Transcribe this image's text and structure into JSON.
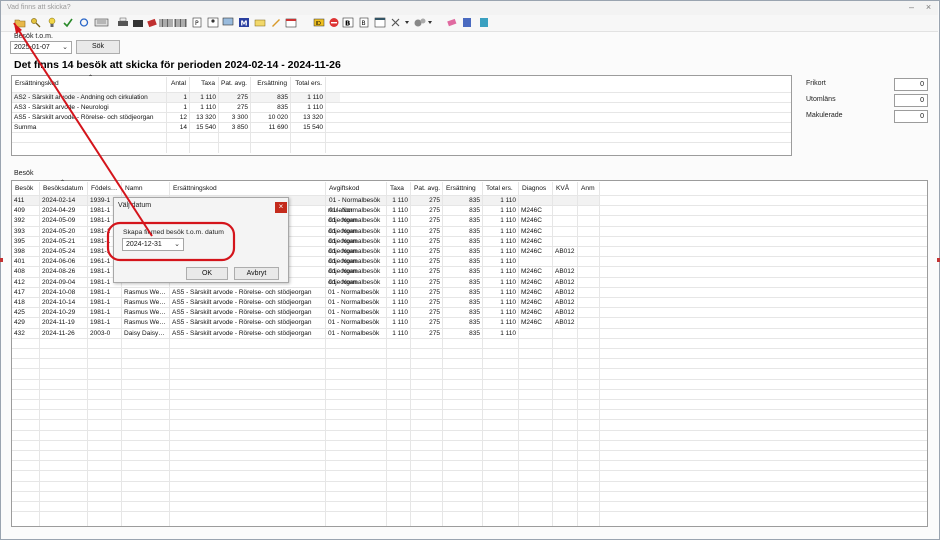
{
  "window": {
    "title": "Vad finns att skicka?",
    "minimize": "–",
    "close": "×"
  },
  "toolbar": {
    "icons": [
      "open-folder-icon",
      "key-icon",
      "lightbulb-icon",
      "check-icon",
      "refresh-icon",
      "keyboard-icon",
      "print-icon",
      "briefcase-icon",
      "eraser-icon",
      "barcode-icon",
      "barcode-icon",
      "barcode-icon",
      "document-p-icon",
      "patient-icon",
      "monitor-icon",
      "m-icon",
      "envelope-icon",
      "pen-icon",
      "calendar-icon",
      "id-icon",
      "stop-icon",
      "b-icon",
      "doc-b-icon",
      "window-icon",
      "tools-icon",
      "gears-icon",
      "eraser-icon",
      "book-icon",
      "document-icon"
    ]
  },
  "search": {
    "label": "Besök t.o.m.",
    "date": "2025-01-07",
    "button": "Sök"
  },
  "heading": "Det finns 14 besök att skicka för perioden 2024-02-14 - 2024-11-26",
  "summary": {
    "columns": [
      "Ersättningskod",
      "Antal",
      "Taxa",
      "Pat. avg.",
      "Ersättning",
      "Total ers."
    ],
    "rows": [
      [
        "AS2 - Särskilt arvode - Andning och cirkulation",
        "1",
        "1 110",
        "275",
        "835",
        "1 110"
      ],
      [
        "AS3 - Särskilt arvode - Neurologi",
        "1",
        "1 110",
        "275",
        "835",
        "1 110"
      ],
      [
        "AS5 - Särskilt arvode - Rörelse- och stödjeorgan",
        "12",
        "13 320",
        "3 300",
        "10 020",
        "13 320"
      ],
      [
        "Summa",
        "14",
        "15 540",
        "3 850",
        "11 690",
        "15 540"
      ]
    ]
  },
  "counts": [
    {
      "label": "Frikort",
      "value": "0"
    },
    {
      "label": "Utomläns",
      "value": "0"
    },
    {
      "label": "Makulerade",
      "value": "0"
    }
  ],
  "visits": {
    "section_label": "Besök",
    "columns": [
      "Besök",
      "Besöksdatum",
      "Födels…",
      "Namn",
      "Ersättningskod",
      "Avgiftskod",
      "Taxa",
      "Pat. avg.",
      "Ersättning",
      "Total ers.",
      "Diagnos",
      "KVÅ",
      "Anm"
    ],
    "rows": [
      [
        "411",
        "2024-02-14",
        "1939-1",
        "",
        "",
        "",
        "1 110",
        "275",
        "835",
        "1 110",
        "",
        "",
        ""
      ],
      [
        "409",
        "2024-04-29",
        "1981-1",
        "",
        "",
        "rkulation",
        "1 110",
        "275",
        "835",
        "1 110",
        "M246C",
        "",
        ""
      ],
      [
        "392",
        "2024-05-09",
        "1981-1",
        "",
        "",
        "ödjeorgan",
        "1 110",
        "275",
        "835",
        "1 110",
        "M246C",
        "",
        ""
      ],
      [
        "393",
        "2024-05-20",
        "1981-1",
        "",
        "",
        "ödjeorgan",
        "1 110",
        "275",
        "835",
        "1 110",
        "M246C",
        "",
        ""
      ],
      [
        "395",
        "2024-05-21",
        "1981-1",
        "",
        "",
        "ödjeorgan",
        "1 110",
        "275",
        "835",
        "1 110",
        "M246C",
        "",
        ""
      ],
      [
        "398",
        "2024-05-24",
        "1981-1",
        "",
        "",
        "ödjeorgan",
        "1 110",
        "275",
        "835",
        "1 110",
        "M246C",
        "AB012",
        ""
      ],
      [
        "401",
        "2024-06-06",
        "1961-1",
        "",
        "",
        "ödjeorgan",
        "1 110",
        "275",
        "835",
        "1 110",
        "",
        "",
        ""
      ],
      [
        "408",
        "2024-08-26",
        "1981-1",
        "",
        "",
        "ödjeorgan",
        "1 110",
        "275",
        "835",
        "1 110",
        "M246C",
        "AB012",
        ""
      ],
      [
        "412",
        "2024-09-04",
        "1981-1",
        "",
        "",
        "ödjeorgan",
        "1 110",
        "275",
        "835",
        "1 110",
        "M246C",
        "AB012",
        ""
      ],
      [
        "417",
        "2024-10-08",
        "1981-1",
        "Rasmus We…",
        "AS5 - Särskilt arvode - Rörelse- och stödjeorgan",
        "01 - Normalbesök",
        "1 110",
        "275",
        "835",
        "1 110",
        "M246C",
        "AB012",
        ""
      ],
      [
        "418",
        "2024-10-14",
        "1981-1",
        "Rasmus We…",
        "AS5 - Särskilt arvode - Rörelse- och stödjeorgan",
        "01 - Normalbesök",
        "1 110",
        "275",
        "835",
        "1 110",
        "M246C",
        "AB012",
        ""
      ],
      [
        "425",
        "2024-10-29",
        "1981-1",
        "Rasmus We…",
        "AS5 - Särskilt arvode - Rörelse- och stödjeorgan",
        "01 - Normalbesök",
        "1 110",
        "275",
        "835",
        "1 110",
        "M246C",
        "AB012",
        ""
      ],
      [
        "429",
        "2024-11-19",
        "1981-1",
        "Rasmus We…",
        "AS5 - Särskilt arvode - Rörelse- och stödjeorgan",
        "01 - Normalbesök",
        "1 110",
        "275",
        "835",
        "1 110",
        "M246C",
        "AB012",
        ""
      ],
      [
        "432",
        "2024-11-26",
        "2003-0",
        "Daisy Daisy…",
        "AS5 - Särskilt arvode - Rörelse- och stödjeorgan",
        "01 - Normalbesök",
        "1 110",
        "275",
        "835",
        "1 110",
        "",
        "",
        ""
      ]
    ],
    "avgiftskod_hidden_rows": "01 - Normalbesök"
  },
  "dialog": {
    "title": "Välj datum",
    "close": "×",
    "label": "Skapa fil med besök t.o.m. datum",
    "date": "2024-12-31",
    "ok": "OK",
    "cancel": "Avbryt"
  },
  "colors": {
    "annotation_red": "#d4141b",
    "selection": "#cde6f7"
  }
}
